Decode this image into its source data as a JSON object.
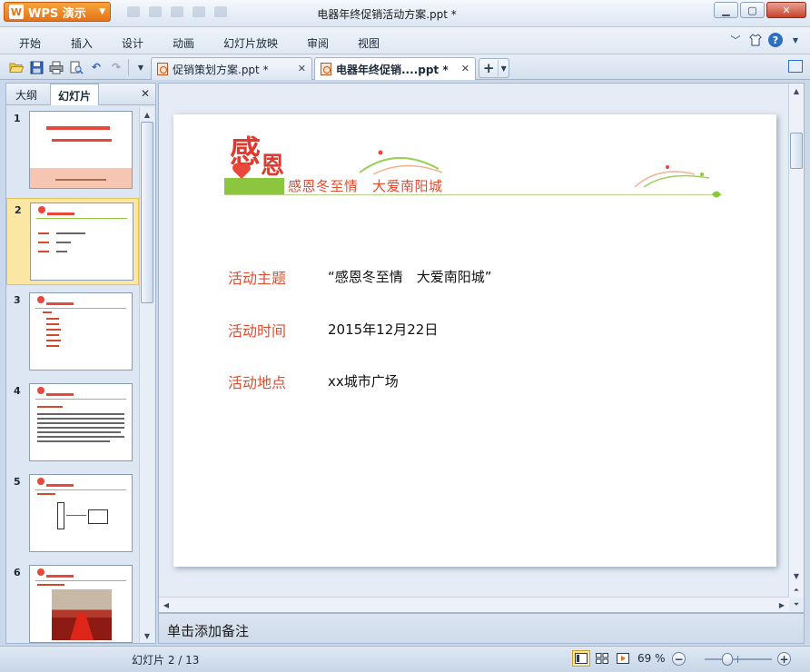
{
  "app": {
    "brand_button": "WPS 演示",
    "window_title": "电器年终促销活动方案.ppt *"
  },
  "menu": {
    "items": [
      "开始",
      "插入",
      "设计",
      "动画",
      "幻灯片放映",
      "审阅",
      "视图"
    ]
  },
  "tabs": [
    {
      "label": "促销策划方案.ppt *",
      "active": false
    },
    {
      "label": "电器年终促销....ppt *",
      "active": true
    }
  ],
  "panel": {
    "tab_outline": "大纲",
    "tab_slides": "幻灯片",
    "thumb_numbers": [
      "1",
      "2",
      "3",
      "4",
      "5",
      "6"
    ],
    "selected": "2"
  },
  "slide": {
    "logo_char1": "感",
    "logo_char2": "恩",
    "tagline": "感恩冬至情　大爱南阳城",
    "rows": [
      {
        "label": "活动主题",
        "value": "“感恩冬至情　大爱南阳城”"
      },
      {
        "label": "活动时间",
        "value": "2015年12月22日"
      },
      {
        "label": "活动地点",
        "value": "xx城市广场"
      }
    ]
  },
  "notes": {
    "placeholder": "单击添加备注"
  },
  "status": {
    "slide_counter": "幻灯片 2 / 13",
    "zoom": "69 %",
    "zoom_level": 0.69
  },
  "colors": {
    "accent_orange": "#e5721a",
    "slide_red": "#e04c2f",
    "leaf_green": "#8cc63f",
    "selected_thumb": "#fbe6a4"
  },
  "icons": {
    "open": "folder-open-icon",
    "save": "save-icon",
    "print": "print-icon",
    "preview": "print-preview-icon",
    "undo": "undo-icon",
    "redo": "redo-icon",
    "help": "help-icon",
    "skin": "shirt-icon"
  }
}
